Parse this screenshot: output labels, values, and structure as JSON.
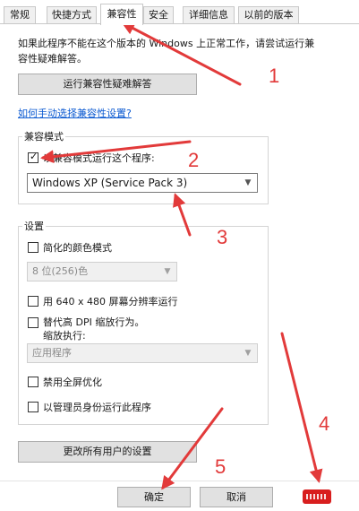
{
  "tabs": [
    {
      "label": "常规"
    },
    {
      "label": "快捷方式"
    },
    {
      "label": "兼容性"
    },
    {
      "label": "安全"
    },
    {
      "label": "详细信息"
    },
    {
      "label": "以前的版本"
    }
  ],
  "hint_text": "如果此程序不能在这个版本的 Windows 上正常工作，请尝试运行兼容性疑难解答。",
  "run_troubleshooter_label": "运行兼容性疑难解答",
  "manual_link": "如何手动选择兼容性设置?",
  "compat_mode": {
    "group_label": "兼容模式",
    "checkbox_label": "以兼容模式运行这个程序:",
    "checked": true,
    "selected_os": "Windows XP (Service Pack 3)"
  },
  "settings": {
    "group_label": "设置",
    "reduced_color_label": "简化的颜色模式",
    "color_select": "8 位(256)色",
    "resolution_label": "用 640 x 480 屏幕分辨率运行",
    "dpi_label_line1": "替代高 DPI 缩放行为。",
    "dpi_label_line2": "缩放执行:",
    "dpi_select": "应用程序",
    "fullscreen_opt_label": "禁用全屏优化",
    "admin_label": "以管理员身份运行此程序"
  },
  "change_all_users_label": "更改所有用户的设置",
  "ok_label": "确定",
  "cancel_label": "取消",
  "annotations": [
    "1",
    "2",
    "3",
    "4",
    "5"
  ],
  "colors": {
    "annotation": "#e23a3a",
    "link": "#0a59d1"
  }
}
